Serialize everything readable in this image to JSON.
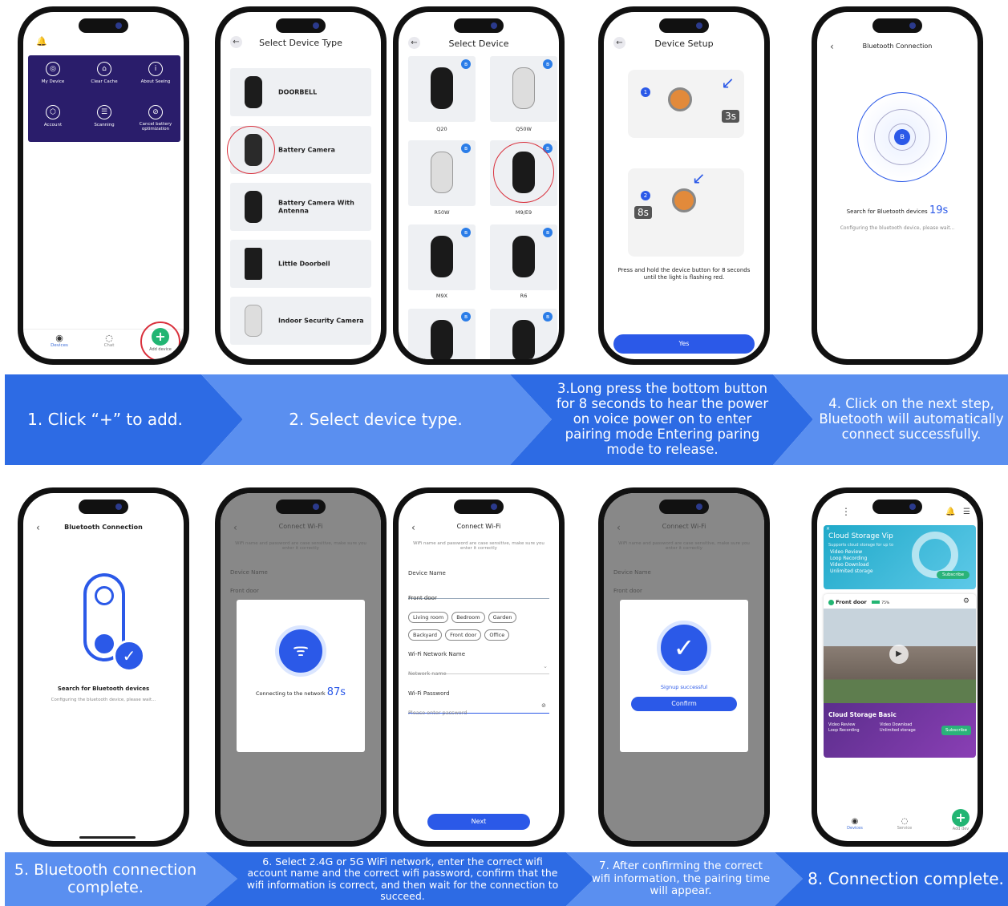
{
  "steps": [
    {
      "text": "1. Click “+” to add."
    },
    {
      "text": "2. Select device type."
    },
    {
      "text": "3.Long press the bottom button for 8 seconds to hear the power on voice power on to enter pairing mode Entering paring mode to release."
    },
    {
      "text": "4. Click on the next step, Bluetooth will automatically connect successfully."
    },
    {
      "text": "5. Bluetooth connection complete."
    },
    {
      "text": "6. Select 2.4G or 5G WiFi network, enter the correct wifi account name and the correct wifi password, confirm that the wifi information is correct, and then wait for the connection to succeed."
    },
    {
      "text": "7. After confirming the correct wifi information, the pairing time will appear."
    },
    {
      "text": "8. Connection complete."
    }
  ],
  "screen1": {
    "menu": [
      "My Device",
      "Clear Cache",
      "About Seeing",
      "Account",
      "Scanning",
      "Cancel battery optimization"
    ],
    "tabs": [
      "Devices",
      "Chat",
      "Add device"
    ]
  },
  "screen2": {
    "title": "Select Device Type",
    "items": [
      "DOORBELL",
      "Battery Camera",
      "Battery Camera With Antenna",
      "Little Doorbell",
      "Indoor Security Camera"
    ]
  },
  "screen3": {
    "title": "Select Device",
    "items": [
      "Q20",
      "Q50W",
      "R50W",
      "M9/E9",
      "M9X",
      "R6"
    ]
  },
  "screen4": {
    "title": "Device Setup",
    "badge1": "3s",
    "badge2": "8s",
    "n1": "1",
    "n2": "2",
    "instruction": "Press and hold the device button for 8 seconds until the light is flashing red.",
    "button": "Yes"
  },
  "screen5": {
    "title": "Bluetooth Connection",
    "search_label": "Search for Bluetooth devices",
    "timer": "19s",
    "sub": "Configuring the bluetooth device, please wait..."
  },
  "screen6": {
    "title": "Bluetooth Connection",
    "search_label": "Search for Bluetooth devices",
    "sub": "Configuring the bluetooth device, please wait..."
  },
  "wifi": {
    "title": "Connect Wi-Fi",
    "note": "WiFi name and password are case sensitive, make sure you enter it correctly",
    "device_name_label": "Device Name",
    "device_name_value": "Front door",
    "chips": [
      "Living room",
      "Bedroom",
      "Garden",
      "Backyard",
      "Front door",
      "Office"
    ],
    "network_label": "Wi-Fi Network Name",
    "network_placeholder": "Network name",
    "password_label": "Wi-Fi Password",
    "password_placeholder": "Please enter password",
    "next": "Next",
    "connecting": "Connecting to the network",
    "connecting_timer": "87s",
    "signup": "Signup successful",
    "confirm": "Confirm"
  },
  "screen10": {
    "vip_title": "Cloud Storage Vip",
    "vip_sub": "Supports cloud storage for up to",
    "vip_features": [
      "Video Review",
      "Loop Recording",
      "Video Download",
      "Unlimited storage"
    ],
    "subscribe": "Subscribe",
    "device": "Front door",
    "battery": "75%",
    "basic_title": "Cloud Storage Basic",
    "basic_features": [
      "Video Review",
      "Video Download",
      "Loop Recording",
      "Unlimited storage"
    ],
    "tabs": [
      "Devices",
      "Service",
      "Add dev"
    ]
  }
}
